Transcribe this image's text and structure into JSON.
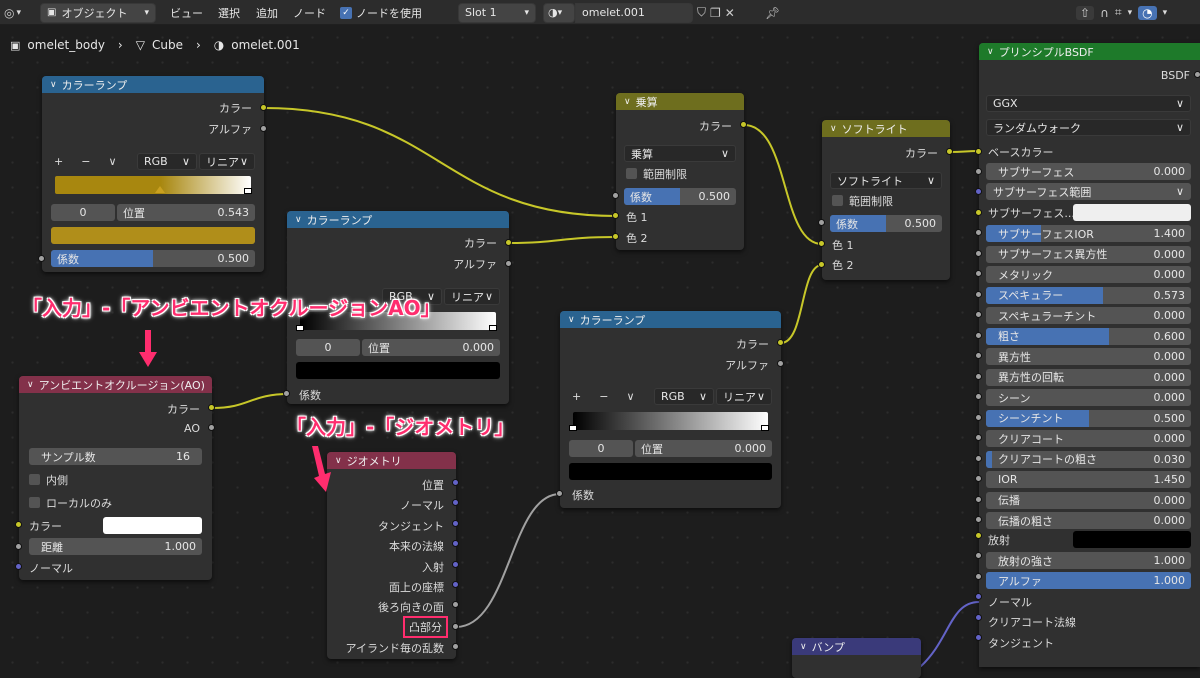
{
  "toolbar": {
    "object_mode": "オブジェクト",
    "menu_view": "ビュー",
    "menu_select": "選択",
    "menu_add": "追加",
    "menu_node": "ノード",
    "use_nodes": "ノードを使用",
    "slot": "Slot 1",
    "material_name": "omelet.001"
  },
  "breadcrumb": {
    "object": "omelet_body",
    "mesh": "Cube",
    "material": "omelet.001"
  },
  "annotations": {
    "ao": "「入力」-「アンビエントオクルージョンAO」",
    "geometry": "「入力」-「ジオメトリ」"
  },
  "colors": {
    "annotation": "#ff2d6e",
    "color_socket": "#c7c729",
    "float_socket": "#a1a1a1",
    "vector_socket": "#6363c7",
    "converter_header": "#2a6390",
    "color_header": "#6e6e1e",
    "input_header": "#83314a",
    "shader_header": "#1e7a2a",
    "vector_header": "#3a3a7a",
    "fill_accent": "#4772b3"
  },
  "ramp1": {
    "title": "カラーランプ",
    "out_color": "カラー",
    "out_alpha": "アルファ",
    "plus": "+",
    "minus": "−",
    "chevron": "∨",
    "mode": "RGB",
    "interp": "リニア",
    "index": "0",
    "pos_label": "位置",
    "pos_value": "0.543",
    "fac_label": "係数",
    "fac_value": "0.500",
    "fac_fill": 0.5,
    "swatch_color": "#b08e1a"
  },
  "ramp2": {
    "title": "カラーランプ",
    "out_color": "カラー",
    "out_alpha": "アルファ",
    "mode": "RGB",
    "interp": "リニア",
    "index": "0",
    "pos_label": "位置",
    "pos_value": "0.000",
    "fac_label": "係数"
  },
  "ramp3": {
    "title": "カラーランプ",
    "out_color": "カラー",
    "out_alpha": "アルファ",
    "plus": "+",
    "minus": "−",
    "chevron": "∨",
    "mode": "RGB",
    "interp": "リニア",
    "index": "0",
    "pos_label": "位置",
    "pos_value": "0.000",
    "fac_label": "係数"
  },
  "multiply": {
    "title": "乗算",
    "out_color": "カラー",
    "blend": "乗算",
    "clamp": "範囲制限",
    "fac_label": "係数",
    "fac_value": "0.500",
    "fac_fill": 0.5,
    "color1": "色 1",
    "color2": "色 2"
  },
  "softlight": {
    "title": "ソフトライト",
    "out_color": "カラー",
    "blend": "ソフトライト",
    "clamp": "範囲制限",
    "fac_label": "係数",
    "fac_value": "0.500",
    "fac_fill": 0.5,
    "color1": "色 1",
    "color2": "色 2"
  },
  "ao": {
    "title": "アンビエントオクルージョン(AO)",
    "out_color": "カラー",
    "out_ao": "AO",
    "samples_label": "サンプル数",
    "samples_value": "16",
    "inside": "内側",
    "only_local": "ローカルのみ",
    "in_color": "カラー",
    "distance_label": "距離",
    "distance_value": "1.000",
    "normal": "ノーマル"
  },
  "geometry": {
    "title": "ジオメトリ",
    "outputs": [
      "位置",
      "ノーマル",
      "タンジェント",
      "本来の法線",
      "入射",
      "面上の座標",
      "後ろ向きの面",
      "凸部分",
      "アイランド毎の乱数"
    ]
  },
  "bsdf": {
    "title": "プリンシプルBSDF",
    "out_bsdf": "BSDF",
    "distribution": "GGX",
    "sss_method": "ランダムウォーク",
    "base_color": "ベースカラー",
    "sss": "サブサーフェス",
    "sss_value": "0.000",
    "sss_radius": "サブサーフェス範囲",
    "sss_color": "サブサーフェス...",
    "rows": [
      {
        "label": "サブサーフェスIOR",
        "value": "1.400",
        "fill": 0.27
      },
      {
        "label": "サブサーフェス異方性",
        "value": "0.000",
        "fill": 0
      },
      {
        "label": "メタリック",
        "value": "0.000",
        "fill": 0
      },
      {
        "label": "スペキュラー",
        "value": "0.573",
        "fill": 0.573
      },
      {
        "label": "スペキュラーチント",
        "value": "0.000",
        "fill": 0
      },
      {
        "label": "粗さ",
        "value": "0.600",
        "fill": 0.6
      },
      {
        "label": "異方性",
        "value": "0.000",
        "fill": 0
      },
      {
        "label": "異方性の回転",
        "value": "0.000",
        "fill": 0
      },
      {
        "label": "シーン",
        "value": "0.000",
        "fill": 0
      },
      {
        "label": "シーンチント",
        "value": "0.500",
        "fill": 0.5
      },
      {
        "label": "クリアコート",
        "value": "0.000",
        "fill": 0
      },
      {
        "label": "クリアコートの粗さ",
        "value": "0.030",
        "fill": 0.03
      },
      {
        "label": "IOR",
        "value": "1.450",
        "fill": 0
      },
      {
        "label": "伝播",
        "value": "0.000",
        "fill": 0
      },
      {
        "label": "伝播の粗さ",
        "value": "0.000",
        "fill": 0
      }
    ],
    "emission": "放射",
    "emission_strength_label": "放射の強さ",
    "emission_strength_value": "1.000",
    "alpha_label": "アルファ",
    "alpha_value": "1.000",
    "alpha_fill": 1,
    "normal": "ノーマル",
    "clearcoat_normal": "クリアコート法線",
    "tangent": "タンジェント"
  },
  "bump": {
    "title": "バンプ"
  }
}
